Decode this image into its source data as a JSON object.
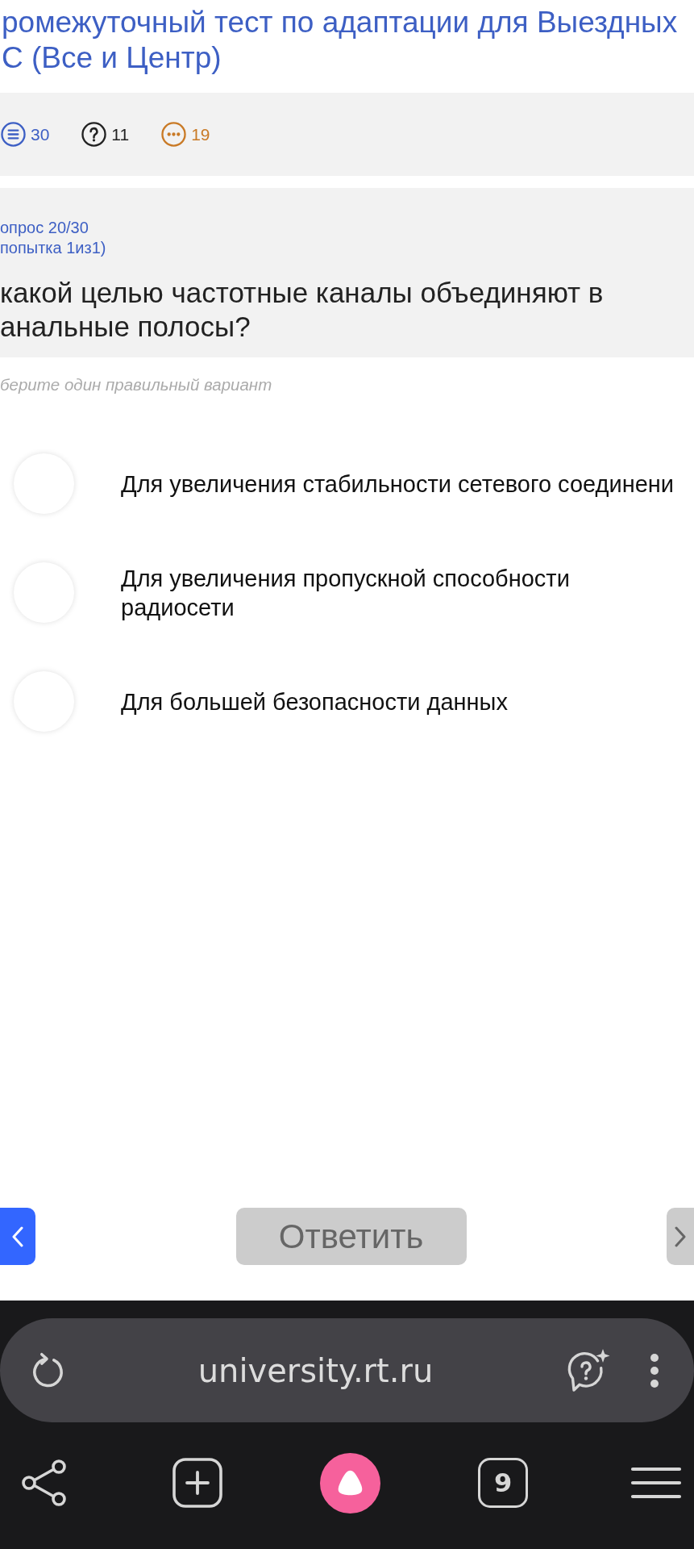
{
  "title_lines": [
    "ромежуточный тест по адаптации для Выездных",
    "С (Все и Центр)"
  ],
  "stats": [
    {
      "kind": "list",
      "count": "30",
      "color": "#3d5fc4"
    },
    {
      "kind": "question",
      "count": "11",
      "color": "#222222"
    },
    {
      "kind": "ellipsis",
      "count": "19",
      "color": "#c97a26"
    }
  ],
  "question": {
    "counter": "опрос 20/30",
    "attempt": "попытка 1из1)",
    "text_lines": [
      "какой целью частотные каналы объединяют в",
      "анальные полосы?"
    ]
  },
  "hint": "берите один правильный вариант",
  "options": [
    {
      "label": "Для увеличения стабильности сетевого соединени",
      "selected": false
    },
    {
      "label": "Для увеличения пропускной способности радиосети",
      "selected": false
    },
    {
      "label": "Для большей безопасности данных",
      "selected": false
    }
  ],
  "nav": {
    "back": {
      "disabled": false
    },
    "answer": {
      "label": "Ответить",
      "disabled": true
    },
    "next": {
      "disabled": true
    }
  },
  "browser": {
    "url": "university.rt.ru",
    "tab_count": "9"
  }
}
